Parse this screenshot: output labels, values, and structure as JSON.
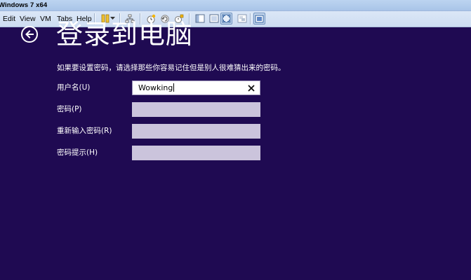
{
  "window": {
    "title": "Windows 7 x64"
  },
  "menu": {
    "edit": "Edit",
    "view": "View",
    "vm": "VM",
    "tabs": "Tabs",
    "help": "Help"
  },
  "toolbar": {
    "icons": [
      "pause-icon",
      "dropdown-arrow-icon",
      "network-icon",
      "snapshot-take-icon",
      "snapshot-revert-icon",
      "snapshot-manager-icon",
      "show-library-icon",
      "console-view-icon",
      "fullscreen-icon",
      "unity-icon",
      "thumbnail-icon"
    ]
  },
  "page": {
    "title": "登录到电脑",
    "description": "如果要设置密码，请选择那些你容易记住但是别人很难猜出来的密码。"
  },
  "form": {
    "username_label": "用户名(U)",
    "username_value": "Wowking",
    "password_label": "密码(P)",
    "password_value": "",
    "confirm_label": "重新输入密码(R)",
    "confirm_value": "",
    "hint_label": "密码提示(H)",
    "hint_value": ""
  },
  "colors": {
    "background": "#1f0a52",
    "field_inactive": "#cbc4dc",
    "text": "#ffffff"
  }
}
